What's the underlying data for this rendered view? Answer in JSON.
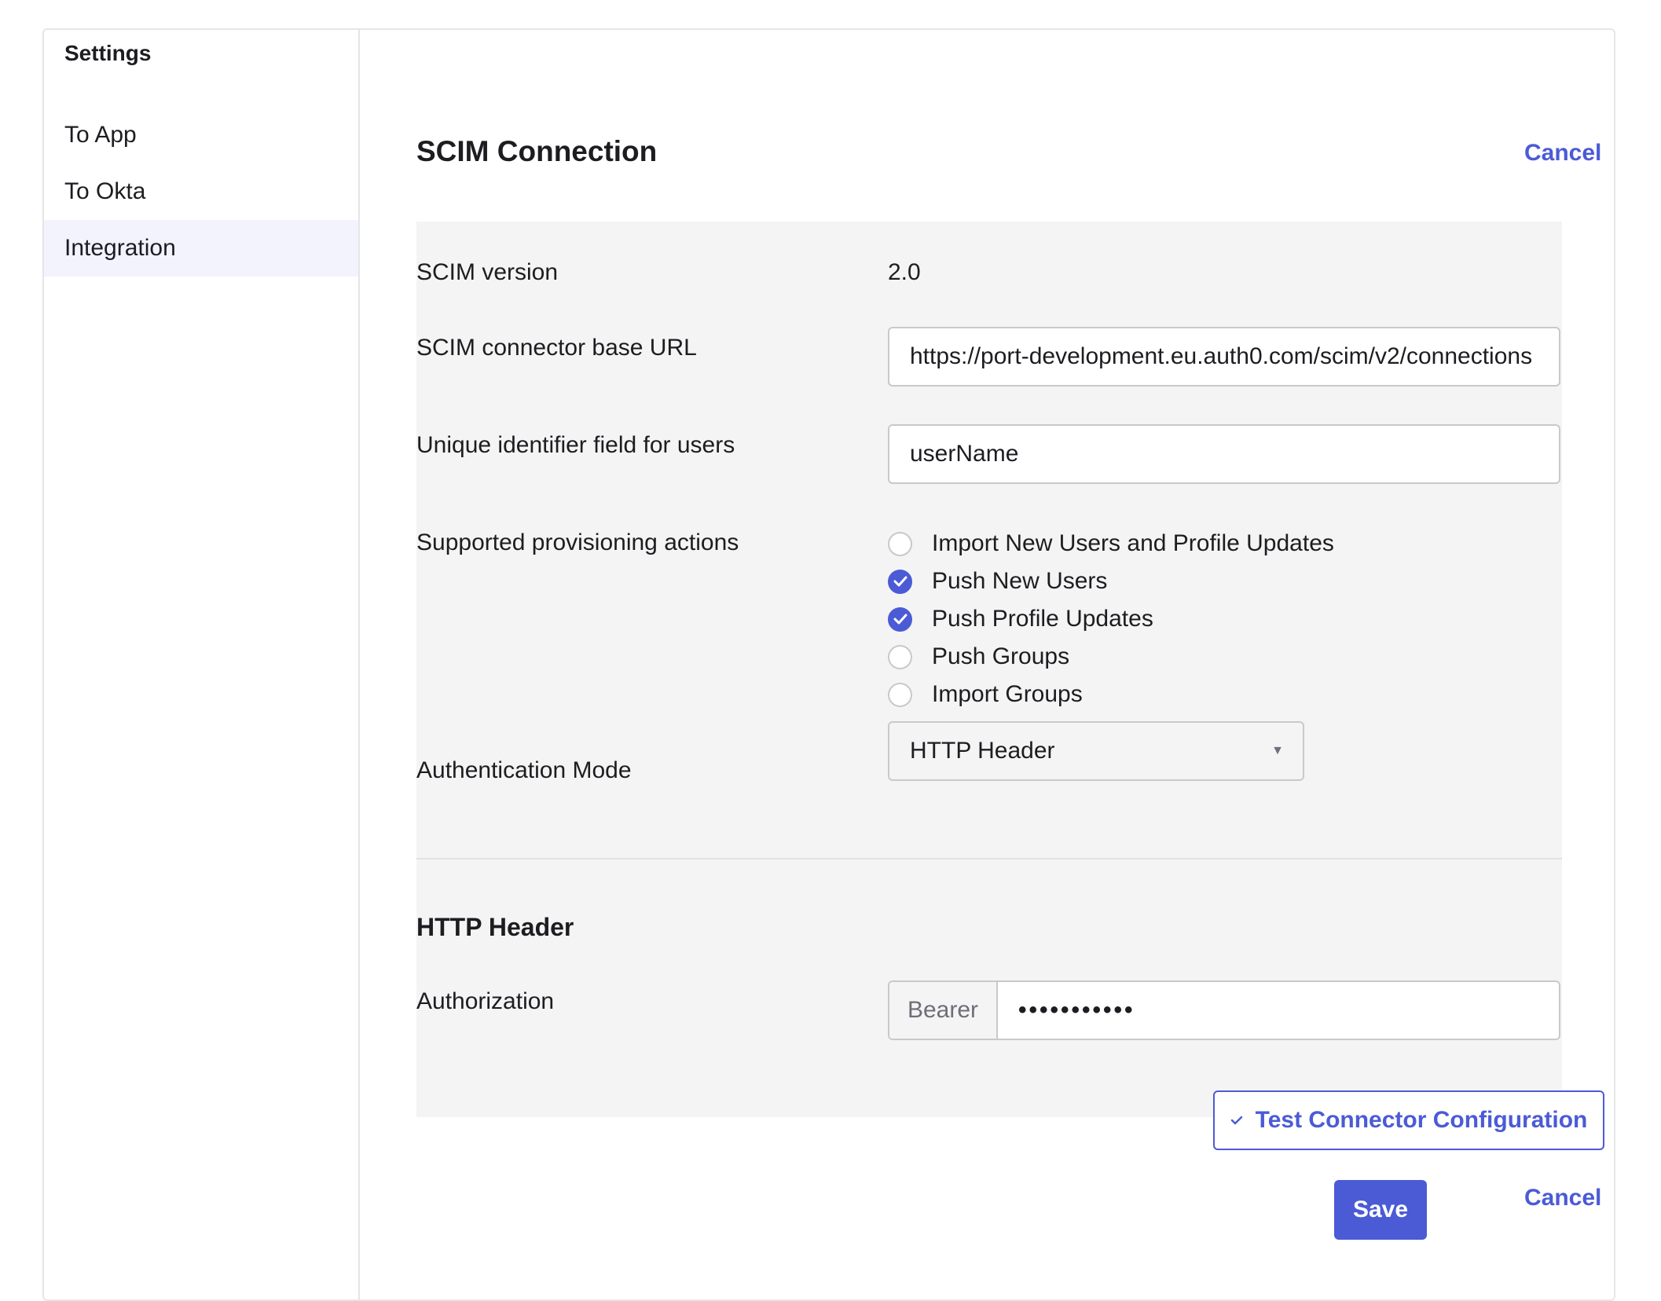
{
  "sidebar": {
    "title": "Settings",
    "items": [
      {
        "label": "To App",
        "active": false
      },
      {
        "label": "To Okta",
        "active": false
      },
      {
        "label": "Integration",
        "active": true
      }
    ]
  },
  "scim": {
    "title": "SCIM Connection",
    "cancel_top_label": "Cancel",
    "version_label": "SCIM version",
    "version_value": "2.0",
    "base_url_label": "SCIM connector base URL",
    "base_url_value": "https://port-development.eu.auth0.com/scim/v2/connections",
    "unique_id_label": "Unique identifier field for users",
    "unique_id_value": "userName",
    "provisioning_label": "Supported provisioning actions",
    "provisioning_actions": [
      {
        "label": "Import New Users and Profile Updates",
        "checked": false
      },
      {
        "label": "Push New Users",
        "checked": true
      },
      {
        "label": "Push Profile Updates",
        "checked": true
      },
      {
        "label": "Push Groups",
        "checked": false
      },
      {
        "label": "Import Groups",
        "checked": false
      }
    ],
    "auth_mode_label": "Authentication Mode",
    "auth_mode_value": "HTTP Header"
  },
  "http_header": {
    "title": "HTTP Header",
    "authorization_label": "Authorization",
    "prefix": "Bearer",
    "token_masked": "•••••••••••"
  },
  "actions": {
    "test_label": "Test Connector Configuration",
    "save_label": "Save",
    "cancel_label": "Cancel"
  },
  "colors": {
    "accent": "#4b5bd6",
    "panel_bg": "#f4f4f4",
    "active_sidebar_bg": "#f2f3fd"
  }
}
